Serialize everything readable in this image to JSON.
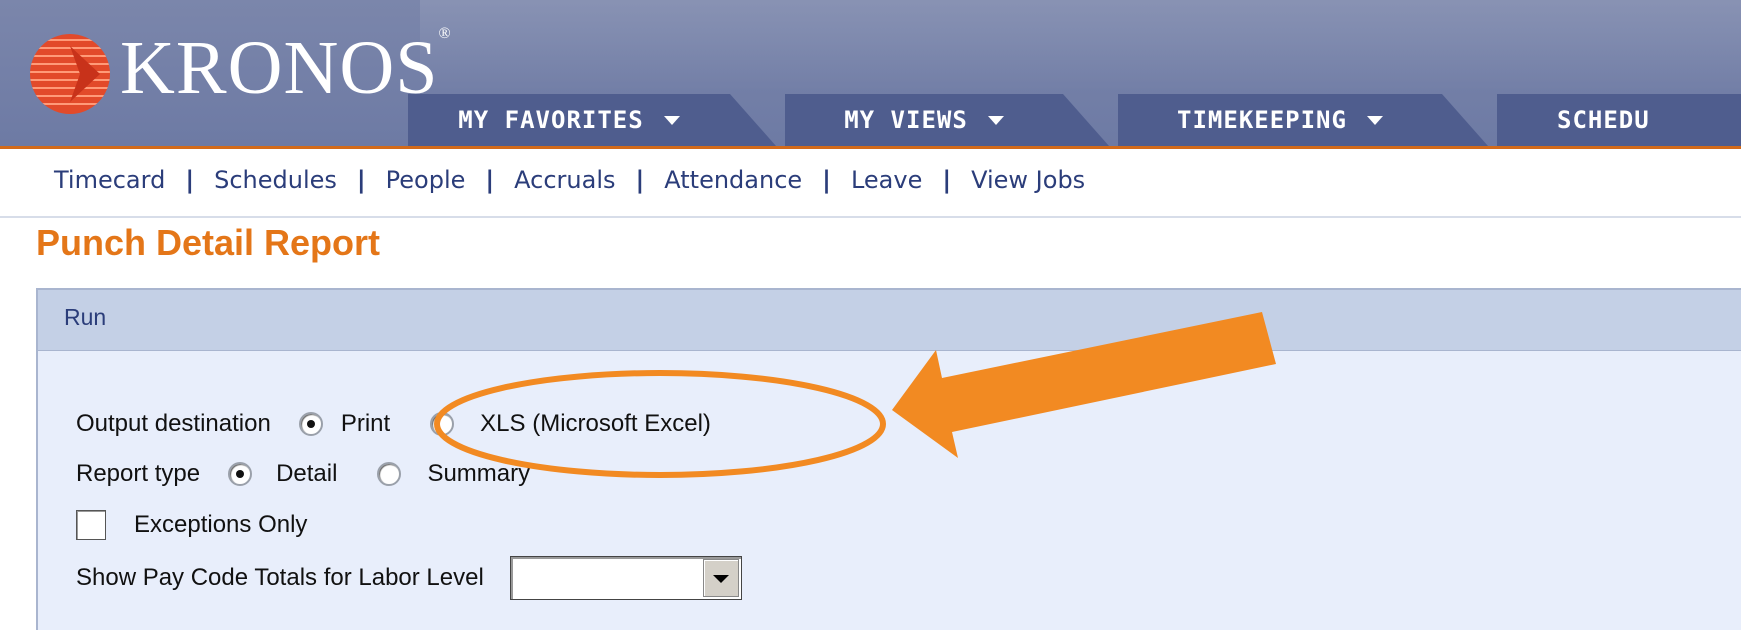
{
  "app": {
    "logo_text": "KRONOS",
    "logo_mark": "registered",
    "brand_color": "#e47618"
  },
  "nav": {
    "tabs": [
      {
        "label": "MY FAVORITES"
      },
      {
        "label": "MY VIEWS"
      },
      {
        "label": "TIMEKEEPING"
      },
      {
        "label": "SCHEDU"
      }
    ]
  },
  "subnav": {
    "links": [
      "Timecard",
      "Schedules",
      "People",
      "Accruals",
      "Attendance",
      "Leave",
      "View Jobs"
    ],
    "separator": "|"
  },
  "page": {
    "title": "Punch Detail Report"
  },
  "panel": {
    "title": "Run",
    "output_destination": {
      "label": "Output destination",
      "options": [
        "Print",
        "XLS (Microsoft Excel)"
      ],
      "selected": "Print"
    },
    "report_type": {
      "label": "Report type",
      "options": [
        "Detail",
        "Summary"
      ],
      "selected": "Detail"
    },
    "exceptions_only": {
      "label": "Exceptions Only",
      "checked": false
    },
    "pay_code_totals": {
      "label": "Show Pay Code Totals for Labor Level",
      "value": ""
    }
  },
  "annotation": {
    "color": "#f28a22",
    "shapes": [
      "ellipse",
      "arrow"
    ]
  }
}
